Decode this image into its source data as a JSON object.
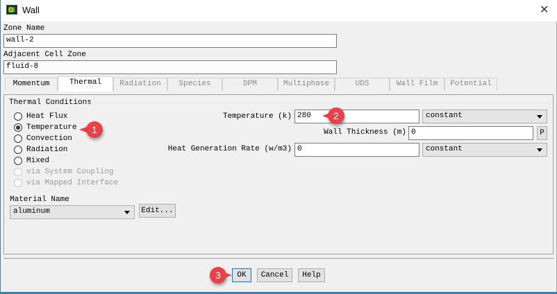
{
  "window": {
    "title": "Wall",
    "close_label": "✕"
  },
  "zone_name": {
    "label": "Zone Name",
    "value": "wall-2"
  },
  "adjacent_cell_zone": {
    "label": "Adjacent Cell Zone",
    "value": "fluid-8"
  },
  "tabs": [
    {
      "label": "Momentum"
    },
    {
      "label": "Thermal"
    },
    {
      "label": "Radiation"
    },
    {
      "label": "Species"
    },
    {
      "label": "DPM"
    },
    {
      "label": "Multiphase"
    },
    {
      "label": "UDS"
    },
    {
      "label": "Wall Film"
    },
    {
      "label": "Potential"
    }
  ],
  "active_tab": "Thermal",
  "thermal": {
    "group_label": "Thermal Conditions",
    "options": [
      {
        "label": "Heat Flux"
      },
      {
        "label": "Temperature"
      },
      {
        "label": "Convection"
      },
      {
        "label": "Radiation"
      },
      {
        "label": "Mixed"
      },
      {
        "label": "via System Coupling"
      },
      {
        "label": "via Mapped Interface"
      }
    ],
    "selected": "Temperature",
    "material_label": "Material Name",
    "material_value": "aluminum",
    "edit_label": "Edit...",
    "temperature_label": "Temperature (k)",
    "temperature_value": "280",
    "temperature_method": "constant",
    "wall_thickness_label": "Wall Thickness (m)",
    "wall_thickness_value": "0",
    "p_label": "P",
    "heat_gen_label": "Heat Generation Rate (w/m3)",
    "heat_gen_value": "0",
    "heat_gen_method": "constant"
  },
  "buttons": {
    "ok": "OK",
    "cancel": "Cancel",
    "help": "Help"
  },
  "callouts": {
    "one": "1",
    "two": "2",
    "three": "3"
  },
  "colors": {
    "callout": "#e8414a",
    "default_button_border": "#0078d7"
  }
}
